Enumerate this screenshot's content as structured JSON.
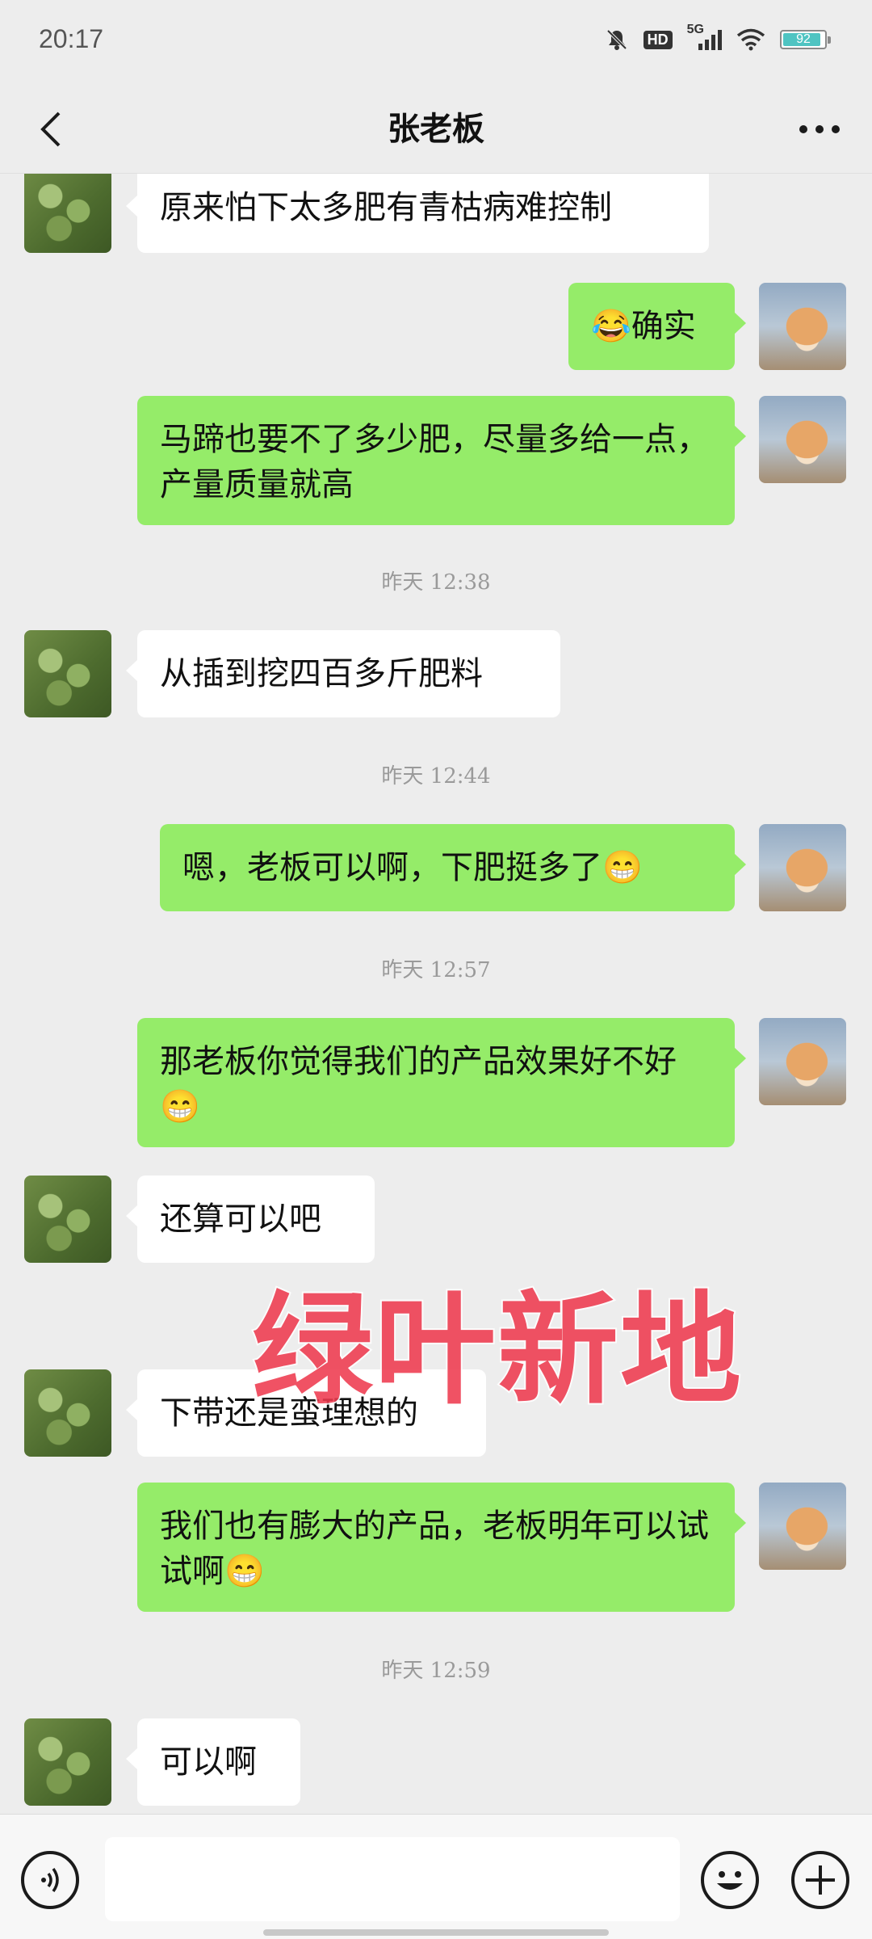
{
  "status_bar": {
    "time": "20:17",
    "network": "5G",
    "hd": "HD",
    "battery": "92",
    "battery_level": 0.92,
    "icons": [
      "mute-bell-icon",
      "hd-icon",
      "cellular-signal-icon",
      "wifi-icon",
      "battery-icon"
    ]
  },
  "header": {
    "title": "张老板",
    "back_icon": "back-arrow-icon",
    "more_icon": "more-dots-icon"
  },
  "messages": [
    {
      "side": "left",
      "text": "原来怕下太多肥有青枯病难控制"
    },
    {
      "side": "right",
      "text": "😂确实"
    },
    {
      "side": "right",
      "text": "马蹄也要不了多少肥，尽量多给一点，产量质量就高"
    },
    {
      "timestamp": "昨天 12:38"
    },
    {
      "side": "left",
      "text": "从插到挖四百多斤肥料"
    },
    {
      "timestamp": "昨天 12:44"
    },
    {
      "side": "right",
      "text": "嗯，老板可以啊，下肥挺多了😁"
    },
    {
      "timestamp": "昨天 12:57"
    },
    {
      "side": "right",
      "text": "那老板你觉得我们的产品效果好不好😁"
    },
    {
      "side": "left",
      "text": "还算可以吧"
    },
    {
      "side": "left",
      "text": "下带还是蛮理想的"
    },
    {
      "side": "right",
      "text": "我们也有膨大的产品，老板明年可以试试啊😁"
    },
    {
      "timestamp": "昨天 12:59"
    },
    {
      "side": "left",
      "text": "可以啊"
    }
  ],
  "watermark": "绿叶新地",
  "input_bar": {
    "voice_icon": "voice-icon",
    "emoji_icon": "emoji-icon",
    "plus_icon": "plus-icon",
    "input_value": ""
  },
  "colors": {
    "background": "#ededed",
    "sent_bubble": "#95ec69",
    "received_bubble": "#ffffff",
    "watermark": "#ef3b4f"
  }
}
